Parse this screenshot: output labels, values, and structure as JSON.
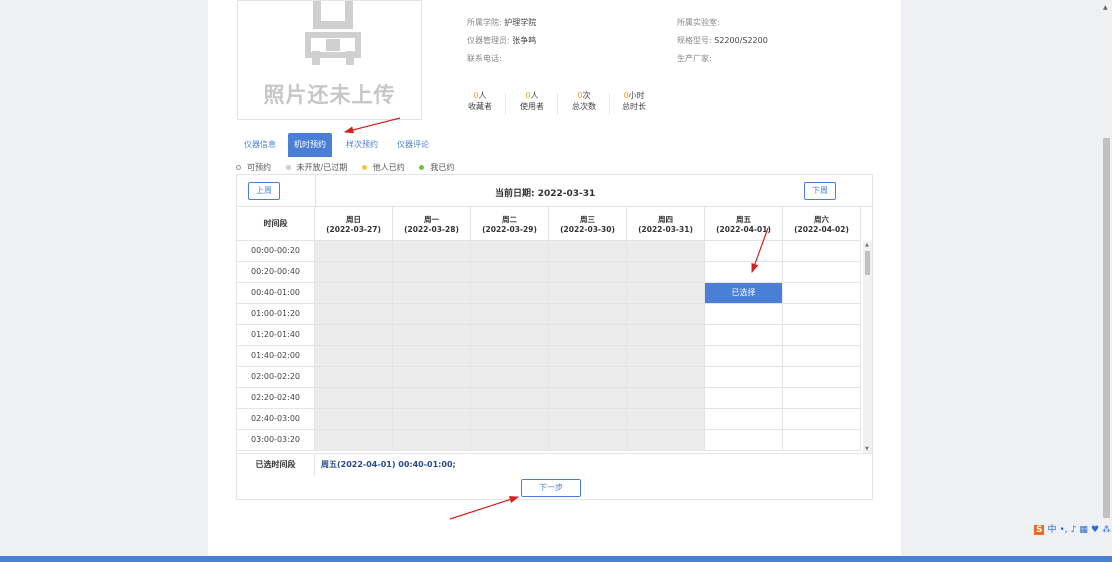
{
  "photo": {
    "placeholder_text": "照片还未上传"
  },
  "info": {
    "college_label": "所属学院:",
    "college_value": "护理学院",
    "admin_label": "仪器管理员:",
    "admin_value": "张争鸣",
    "phone_label": "联系电话:",
    "phone_value": "",
    "lab_label": "所属实验室:",
    "lab_value": "",
    "model_label": "规格型号:",
    "model_value": "S2200/S2200",
    "maker_label": "生产厂家:",
    "maker_value": ""
  },
  "stats": [
    {
      "num": "0",
      "unit": "人",
      "label": "收藏者"
    },
    {
      "num": "0",
      "unit": "人",
      "label": "使用者"
    },
    {
      "num": "0",
      "unit": "次",
      "label": "总次数"
    },
    {
      "num": "0",
      "unit": "小时",
      "label": "总时长"
    }
  ],
  "tabs": [
    "仪器信息",
    "机时预约",
    "样次预约",
    "仪器评论"
  ],
  "active_tab": "机时预约",
  "legend": {
    "available": "可预约",
    "closed": "未开放/已过期",
    "others": "他人已约",
    "mine": "我已约"
  },
  "colors": {
    "accent": "#4a7fd6",
    "others": "#f5c542",
    "mine": "#6cc24a",
    "closed": "#d0d0d0"
  },
  "calendar": {
    "prev_week": "上周",
    "next_week": "下周",
    "current_date_label": "当前日期:",
    "current_date": "2022-03-31",
    "time_header": "时间段",
    "days": [
      {
        "name": "周日",
        "date": "(2022-03-27)"
      },
      {
        "name": "周一",
        "date": "(2022-03-28)"
      },
      {
        "name": "周二",
        "date": "(2022-03-29)"
      },
      {
        "name": "周三",
        "date": "(2022-03-30)"
      },
      {
        "name": "周四",
        "date": "(2022-03-31)"
      },
      {
        "name": "周五",
        "date": "(2022-04-01)"
      },
      {
        "name": "周六",
        "date": "(2022-04-02)"
      }
    ],
    "slots": [
      "00:00-00:20",
      "00:20-00:40",
      "00:40-01:00",
      "01:00-01:20",
      "01:20-01:40",
      "01:40-02:00",
      "02:00-02:20",
      "02:20-02:40",
      "02:40-03:00",
      "03:00-03:20"
    ],
    "selected_cell_text": "已选择",
    "selected_label": "已选时间段",
    "selected_value": "周五(2022-04-01) 00:40-01:00;"
  },
  "next_step": "下一步",
  "ime": {
    "lang": "中"
  }
}
